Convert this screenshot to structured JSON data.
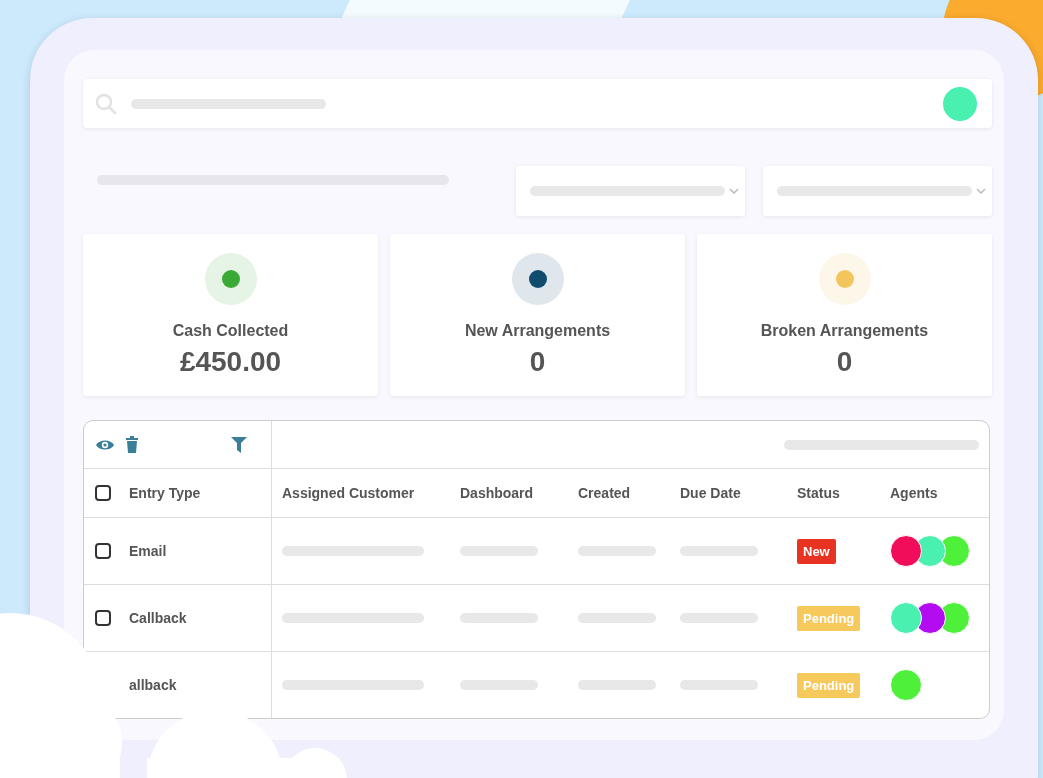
{
  "stats": [
    {
      "label": "Cash Collected",
      "value": "£450.00",
      "color": "#3aa935"
    },
    {
      "label": "New Arrangements",
      "value": "0",
      "color": "#0f4c6e"
    },
    {
      "label": "Broken Arrangements",
      "value": "0",
      "color": "#f2c65c"
    }
  ],
  "avatar": {
    "color": "#4af0b0"
  },
  "table": {
    "columns": [
      "Entry Type",
      "Assigned Customer",
      "Dashboard",
      "Created",
      "Due Date",
      "Status",
      "Agents"
    ],
    "header_checkbox": {
      "checked": false
    },
    "rows": [
      {
        "entry_type": "Email",
        "checked": false,
        "status": {
          "label": "New",
          "kind": "new"
        },
        "agents": [
          {
            "color": "#f20d5a"
          },
          {
            "color": "#4af0b0"
          },
          {
            "color": "#4ff03a"
          }
        ]
      },
      {
        "entry_type": "Callback",
        "checked": false,
        "status": {
          "label": "Pending",
          "kind": "pending"
        },
        "agents": [
          {
            "color": "#4af0b0"
          },
          {
            "color": "#b40cf0"
          },
          {
            "color": "#4ff03a"
          }
        ]
      },
      {
        "entry_type": "allback",
        "status": {
          "label": "Pending",
          "kind": "pending"
        },
        "agents": [
          {
            "color": "#4ff03a"
          }
        ]
      }
    ]
  }
}
